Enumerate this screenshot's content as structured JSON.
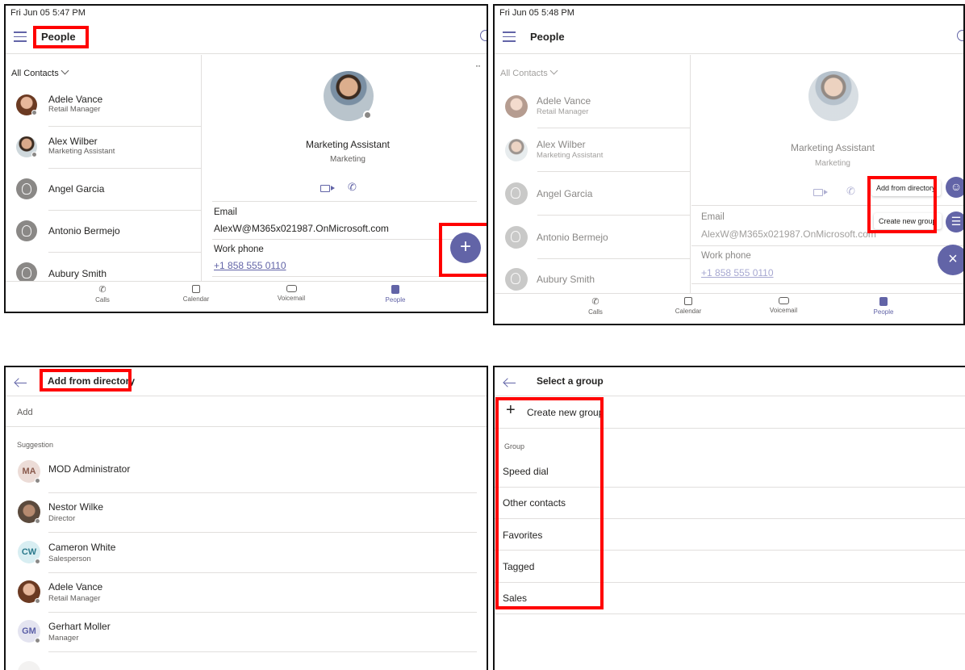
{
  "panel1": {
    "status": "Fri Jun 05  5:47 PM",
    "title": "People",
    "filter": "All Contacts",
    "contacts": [
      {
        "name": "Adele Vance",
        "title": "Retail Manager"
      },
      {
        "name": "Alex Wilber",
        "title": "Marketing Assistant"
      },
      {
        "name": "Angel Garcia",
        "title": ""
      },
      {
        "name": "Antonio Bermejo",
        "title": ""
      },
      {
        "name": "Aubury Smith",
        "title": ""
      }
    ],
    "detail": {
      "role": "Marketing Assistant",
      "department": "Marketing",
      "email_label": "Email",
      "email_value": "AlexW@M365x021987.OnMicrosoft.com",
      "phone_label": "Work phone",
      "phone_value": "+1 858 555 0110",
      "more": "··"
    },
    "fab": "+",
    "tabs": [
      "Calls",
      "Calendar",
      "Voicemail",
      "People"
    ]
  },
  "panel2": {
    "status": "Fri Jun 05  5:48 PM",
    "title": "People",
    "filter": "All Contacts",
    "contacts": [
      {
        "name": "Adele Vance",
        "title": "Retail Manager"
      },
      {
        "name": "Alex Wilber",
        "title": "Marketing Assistant"
      },
      {
        "name": "Angel Garcia",
        "title": ""
      },
      {
        "name": "Antonio Bermejo",
        "title": ""
      },
      {
        "name": "Aubury Smith",
        "title": ""
      }
    ],
    "detail": {
      "role": "Marketing Assistant",
      "department": "Marketing",
      "email_label": "Email",
      "email_value": "AlexW@M365x021987.OnMicrosoft.com",
      "phone_label": "Work phone",
      "phone_value": "+1 858 555 0110"
    },
    "menu": {
      "add_from_directory": "Add from directory",
      "create_new_group": "Create new group"
    },
    "close": "×",
    "tabs": [
      "Calls",
      "Calendar",
      "Voicemail",
      "People"
    ]
  },
  "panel3": {
    "title": "Add from directory",
    "add_placeholder": "Add",
    "section": "Suggestion",
    "people": [
      {
        "initials": "MA",
        "name": "MOD Administrator",
        "title": ""
      },
      {
        "initials": "",
        "name": "Nestor Wilke",
        "title": "Director"
      },
      {
        "initials": "CW",
        "name": "Cameron White",
        "title": "Salesperson"
      },
      {
        "initials": "",
        "name": "Adele Vance",
        "title": "Retail Manager"
      },
      {
        "initials": "GM",
        "name": "Gerhart Moller",
        "title": "Manager"
      }
    ]
  },
  "panel4": {
    "title": "Select a group",
    "create": "Create new group",
    "section": "Group",
    "groups": [
      "Speed dial",
      "Other contacts",
      "Favorites",
      "Tagged",
      "Sales"
    ]
  },
  "colors": {
    "accent": "#6264a7",
    "highlight": "#ff0000"
  }
}
